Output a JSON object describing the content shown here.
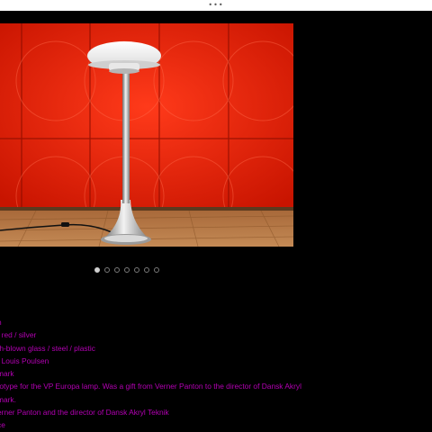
{
  "header": {
    "menu_icon": "more-dots-icon",
    "menu_glyph": "•••"
  },
  "gallery": {
    "current_index": 1,
    "total_images": 7,
    "image_semantic": "mushroom-floor-lamp-red-wall-photo"
  },
  "details": {
    "lines": [
      "n",
      "/ red / silver",
      "th-blown glass / steel / plastic",
      ": Louis Poulsen",
      "mark",
      "totype for the VP Europa lamp. Was a gift from Verner Panton to the director of Dansk Akryl",
      "mark.",
      "erner Panton and the director of Dansk Akryl Teknik",
      "ce"
    ]
  },
  "colors": {
    "background": "#000000",
    "text_accent": "#b300b3",
    "wall_red": "#d81e06",
    "topbar": "#ffffff"
  }
}
